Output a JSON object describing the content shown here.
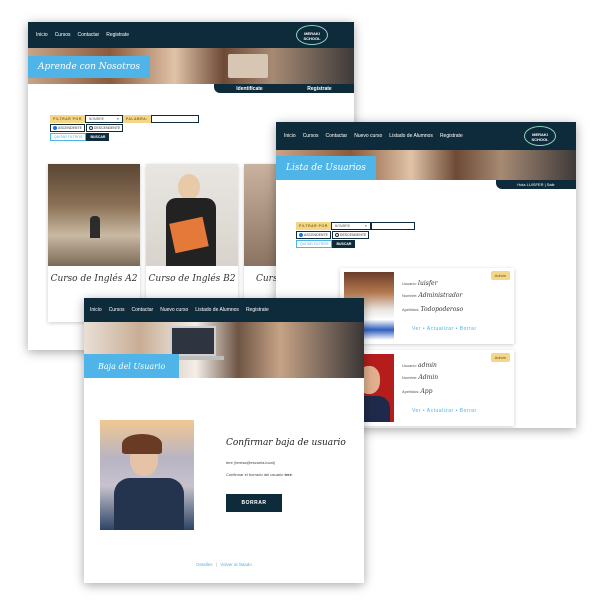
{
  "screen1": {
    "nav": [
      "Inicio",
      "Cursos",
      "Contactar",
      "Registrate"
    ],
    "logo": "MERAKI SCHOOL",
    "title": "Aprende con Nosotros",
    "subnav": [
      "Identifícate",
      "Registrate"
    ],
    "filter": {
      "label": "FILTRAR POR",
      "select": "NOMBRE",
      "word_label": "PALABRA:",
      "asc": "ASCENDENTE",
      "desc": "DESCENDENTE",
      "clear": "QUITAR FILTROS",
      "search": "BUSCAR"
    },
    "courses": [
      "Curso de Inglés A2",
      "Curso de Inglés B2",
      "Curs"
    ]
  },
  "screen2": {
    "nav": [
      "Inicio",
      "Cursos",
      "Contactar",
      "Nuevo curso",
      "Listado de Alumnos",
      "Registrate"
    ],
    "logo": "MERAKI SCHOOL",
    "title": "Lista de Usuarios",
    "session": "Hola LUISFER | Salir",
    "filter": {
      "label": "FILTRAR POR",
      "select": "NOMBRE",
      "asc": "ASCENDENTE",
      "desc": "DESCENDENTE",
      "clear": "QUITAR FILTROS",
      "search": "BUSCAR"
    },
    "users": [
      {
        "usuario_label": "Usuario:",
        "usuario": "luisfer",
        "nombre_label": "Nombre:",
        "nombre": "Administrador",
        "apellidos_label": "Apellidos:",
        "apellidos": "Todopoderoso",
        "badge": "Admin",
        "actions": "Ver • Actualizar • Borrar"
      },
      {
        "usuario_label": "Usuario:",
        "usuario": "admin",
        "nombre_label": "Nombre:",
        "nombre": "Admin",
        "apellidos_label": "Apellidos:",
        "apellidos": "App",
        "badge": "Admin",
        "actions": "Ver • Actualizar • Borrar"
      }
    ]
  },
  "screen3": {
    "nav": [
      "Inicio",
      "Cursos",
      "Contactar",
      "Nuevo curso",
      "Listado de Alumnos",
      "Registrate"
    ],
    "title": "Baja del Usuario",
    "heading": "Confirmar baja de usuario",
    "email": "tere (teresa@escuela.local)",
    "confirm_prefix": "Confirmar el borrado del usuario",
    "confirm_user": "tere",
    "confirm_suffix": ".",
    "button": "BORRAR",
    "footer_link1": "Detalles",
    "footer_sep": "|",
    "footer_link2": "Volver al listado"
  },
  "colors": {
    "navy": "#0e2b3c",
    "sky": "#4fb4e8",
    "gold": "#f3d687"
  }
}
